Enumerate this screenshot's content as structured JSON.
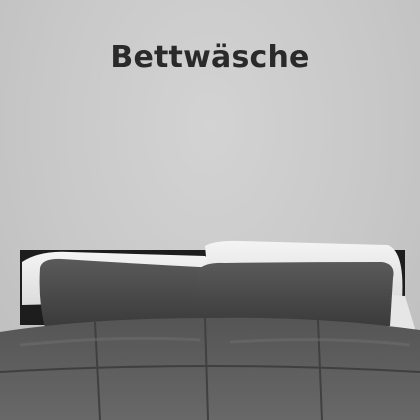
{
  "banner": {
    "title": "Bettwäsche"
  },
  "scene": {
    "subject": "bed-with-dark-grey-plush-comforter-and-pillows",
    "colors": {
      "wall": "#c9c9c9",
      "headboard": "#1e1e1e",
      "plush": "#4a4a4a",
      "white_pillow": "#eeeeee"
    }
  }
}
